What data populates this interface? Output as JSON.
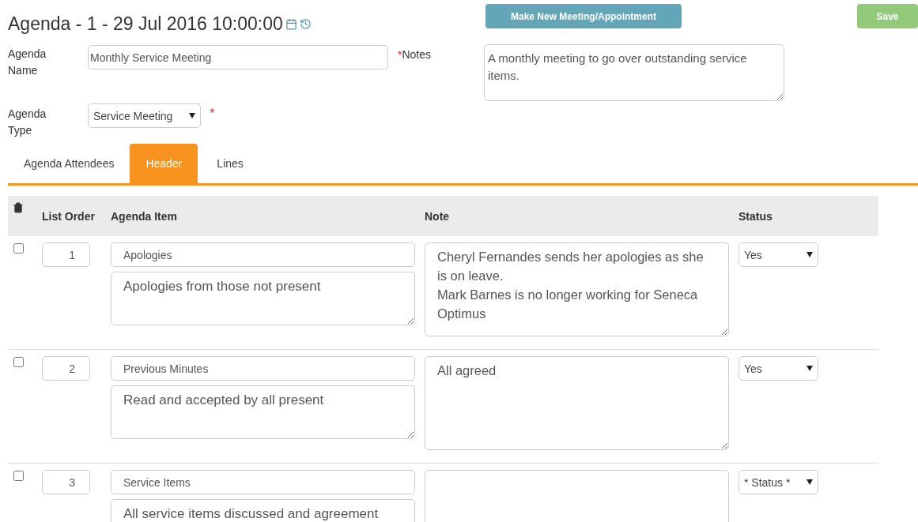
{
  "title": "Agenda - 1 - 29 Jul 2016 10:00:00",
  "buttons": {
    "new_meeting": "Make New Meeting/Appointment",
    "save": "Save"
  },
  "form": {
    "agenda_name": {
      "label": "Agenda Name",
      "value": "Monthly Service Meeting"
    },
    "notes": {
      "label": "Notes",
      "required_mark": "*",
      "value": "A monthly meeting to go over outstanding service items."
    },
    "agenda_type": {
      "label": "Agenda Type",
      "value": "Service Meeting",
      "required_mark": "*"
    }
  },
  "tabs": [
    {
      "label": "Agenda Attendees",
      "selected": false
    },
    {
      "label": "Header",
      "selected": true
    },
    {
      "label": "Lines",
      "selected": false
    }
  ],
  "table": {
    "columns": [
      "List Order",
      "Agenda Item",
      "Note",
      "Status"
    ],
    "rows": [
      {
        "checked": false,
        "order": "1",
        "item": "Apologies",
        "description": "Apologies from those not present",
        "note": "Cheryl Fernandes sends her apologies as she is on leave.\nMark Barnes is no longer working for Seneca Optimus",
        "status": "Yes"
      },
      {
        "checked": false,
        "order": "2",
        "item": "Previous Minutes",
        "description": "Read and accepted by all present",
        "note": "All agreed",
        "status": "Yes"
      },
      {
        "checked": false,
        "order": "3",
        "item": "Service Items",
        "description": "All service items discussed and agreement",
        "note": "",
        "status": "* Status *"
      }
    ]
  }
}
